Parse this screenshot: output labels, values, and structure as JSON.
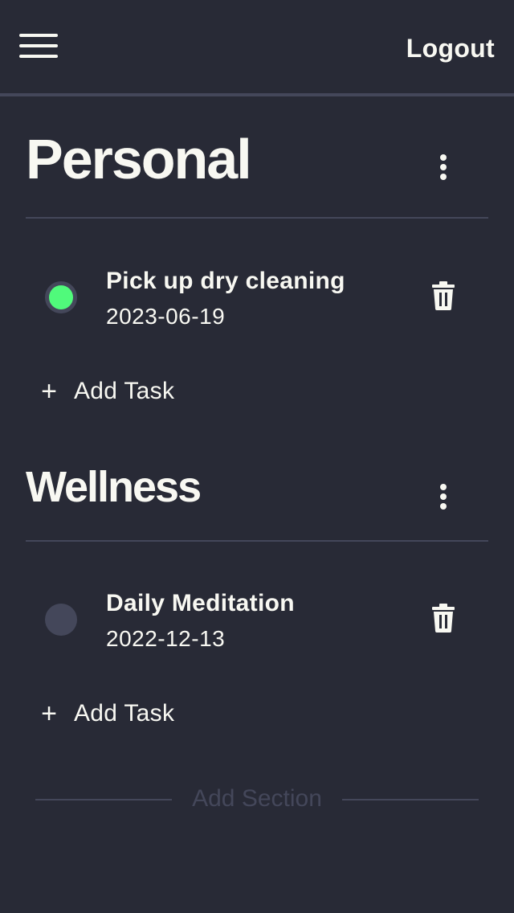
{
  "header": {
    "menu_icon": "hamburger-menu-icon",
    "logout_label": "Logout"
  },
  "sections": [
    {
      "title": "Personal",
      "more_icon": "vertical-ellipsis-icon",
      "tasks": [
        {
          "title": "Pick up dry cleaning",
          "date": "2023-06-19",
          "completed": true
        }
      ],
      "add_task_label": "Add Task"
    },
    {
      "title": "Wellness",
      "more_icon": "vertical-ellipsis-icon",
      "tasks": [
        {
          "title": "Daily Meditation",
          "date": "2022-12-13",
          "completed": false
        }
      ],
      "add_task_label": "Add Task"
    }
  ],
  "add_section_label": "Add Section",
  "colors": {
    "background": "#282a36",
    "text": "#f8f8f2",
    "muted": "#44475a",
    "done": "#50fa7b"
  }
}
